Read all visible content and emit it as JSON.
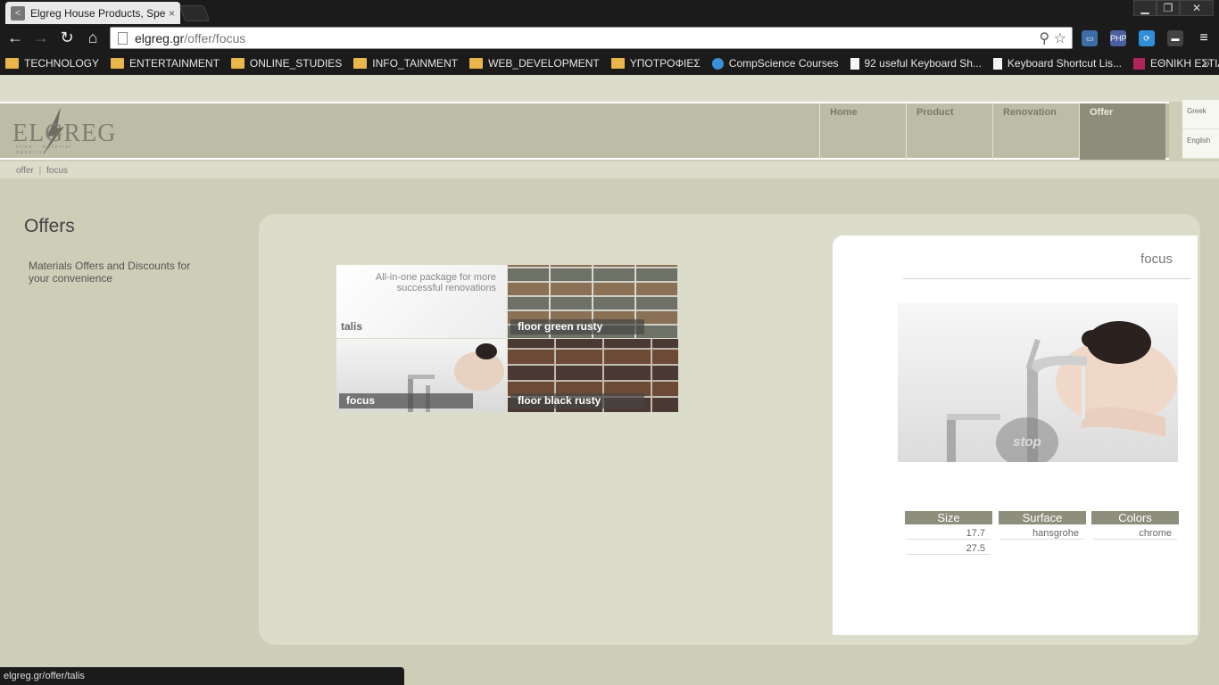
{
  "browser": {
    "tab_title": "Elgreg House Products, Spec",
    "tab_close": "×",
    "url_host": "elgreg.gr",
    "url_path": "/offer/focus",
    "window_min": "▁",
    "window_restore": "❐",
    "window_close": "✕",
    "bookmarks": [
      {
        "label": "TECHNOLOGY",
        "icon": "folder-icon"
      },
      {
        "label": "ENTERTAINMENT",
        "icon": "folder-icon"
      },
      {
        "label": "ONLINE_STUDIES",
        "icon": "folder-icon"
      },
      {
        "label": "INFO_TAINMENT",
        "icon": "folder-icon"
      },
      {
        "label": "WEB_DEVELOPMENT",
        "icon": "folder-icon"
      },
      {
        "label": "ΥΠΟΤΡΟΦΙΕΣ",
        "icon": "folder-icon"
      },
      {
        "label": "CompScience Courses",
        "icon": "site-icon"
      },
      {
        "label": "92 useful Keyboard Sh...",
        "icon": "page-icon"
      },
      {
        "label": "Keyboard Shortcut Lis...",
        "icon": "page-icon"
      },
      {
        "label": "ΕΘΝΙΚΗ ΕΣΤΙΑ ΕΠΙΣΤ...",
        "icon": "site-icon"
      }
    ],
    "bookmarks_more": "»",
    "status_url": "elgreg.gr/offer/talis"
  },
  "site": {
    "logo_text": "ELGREG",
    "logo_tagline": "tiles · material · aquarise",
    "menu": [
      "Home",
      "Product",
      "Renovation",
      "Offer"
    ],
    "active_menu": "Offer",
    "languages": [
      "Greek",
      "English"
    ],
    "breadcrumb": [
      "offer",
      "focus"
    ],
    "breadcrumb_sep": "|"
  },
  "sidebar": {
    "title": "Offers",
    "description": "Materials Offers and Discounts for your convenience"
  },
  "offers": [
    {
      "name": "talis",
      "promo": "All-in-one package for more successful renovations"
    },
    {
      "name": "floor green rusty"
    },
    {
      "name": "focus"
    },
    {
      "name": "floor black rusty"
    }
  ],
  "detail": {
    "name": "focus",
    "stop_label": "stop",
    "spec_headers": {
      "size": "Size",
      "surface": "Surface",
      "colors": "Colors"
    },
    "sizes": [
      "17.7",
      "27.5"
    ],
    "surface": "hansgrohe",
    "colors": "chrome"
  },
  "colors": {
    "page_bg": "#cdcdb8",
    "header_bg": "#bcbca7",
    "menu_active": "#8d8d7b",
    "panel_bg": "#dcdccb",
    "spec_header": "#8e8e7c"
  }
}
